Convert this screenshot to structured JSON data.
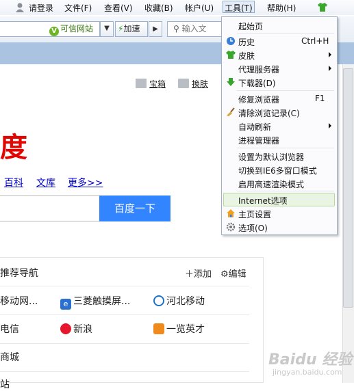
{
  "menubar": {
    "login": "请登录",
    "file": "文件(F)",
    "view": "查看(V)",
    "favorites": "收藏(B)",
    "account": "帐户(U)",
    "tools": "工具(T)",
    "help": "帮助(H)"
  },
  "addressbar": {
    "trusted_label": "可信网站",
    "trusted_badge": "V",
    "accelerate_label": "加速",
    "search_placeholder": "输入文"
  },
  "page": {
    "top_links": [
      "宝箱",
      "换肤"
    ],
    "logo_text": "度",
    "nav_links": [
      "百科",
      "文库",
      "更多>>"
    ],
    "search_button": "百度一下",
    "panel_title": "推荐导航",
    "panel_add": "添加",
    "panel_edit": "编辑",
    "rows": [
      [
        "移动网...",
        "三菱触摸屏...",
        "河北移动"
      ],
      [
        "电信",
        "新浪",
        "一览英才"
      ],
      [
        "商城",
        "",
        ""
      ],
      [
        "站",
        "",
        ""
      ]
    ]
  },
  "tools_menu": {
    "items": [
      {
        "label": "起始页",
        "shortcut": "",
        "submenu": false,
        "icon": ""
      },
      {
        "label": "历史",
        "shortcut": "Ctrl+H",
        "submenu": false,
        "icon": "history-icon"
      },
      {
        "label": "皮肤",
        "shortcut": "",
        "submenu": true,
        "icon": "skin-icon"
      },
      {
        "label": "代理服务器",
        "shortcut": "",
        "submenu": true,
        "icon": ""
      },
      {
        "label": "下载器(D)",
        "shortcut": "",
        "submenu": false,
        "icon": "download-icon"
      },
      {
        "label": "修复浏览器",
        "shortcut": "F1",
        "submenu": false,
        "icon": ""
      },
      {
        "label": "清除浏览记录(C)",
        "shortcut": "",
        "submenu": false,
        "icon": "broom-icon"
      },
      {
        "label": "自动刷新",
        "shortcut": "",
        "submenu": true,
        "icon": ""
      },
      {
        "label": "进程管理器",
        "shortcut": "",
        "submenu": false,
        "icon": ""
      },
      {
        "label": "设置为默认浏览器",
        "shortcut": "",
        "submenu": false,
        "icon": ""
      },
      {
        "label": "切换到IE6多窗口模式",
        "shortcut": "",
        "submenu": false,
        "icon": ""
      },
      {
        "label": "启用高速渲染模式",
        "shortcut": "",
        "submenu": false,
        "icon": ""
      },
      {
        "label": "Internet选项",
        "shortcut": "",
        "submenu": false,
        "icon": ""
      },
      {
        "label": "主页设置",
        "shortcut": "",
        "submenu": false,
        "icon": "home-icon"
      },
      {
        "label": "选项(O)",
        "shortcut": "",
        "submenu": false,
        "icon": "gear-icon"
      }
    ]
  },
  "watermark": {
    "main": "Baidu 经验",
    "sub": "jingyan.baidu.com"
  },
  "colors": {
    "baidu_red": "#e10601",
    "search_button_blue": "#3385ff",
    "band_blue": "#a9c3e0",
    "menu_highlight": "#eaf4e2"
  }
}
